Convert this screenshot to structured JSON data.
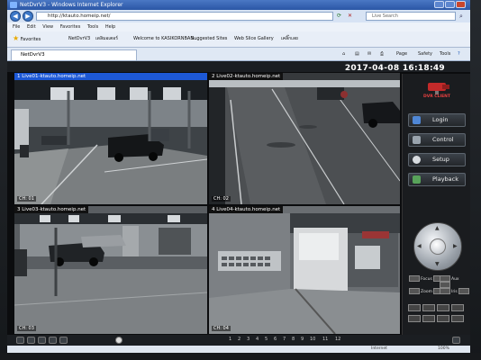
{
  "window": {
    "title": "NetDvrV3 - Windows Internet Explorer"
  },
  "address_bar": {
    "url": "http://ktauto.homeip.net/",
    "search_placeholder": "Live Search"
  },
  "menu": [
    "File",
    "Edit",
    "View",
    "Favorites",
    "Tools",
    "Help"
  ],
  "favorites_bar": {
    "label": "Favorites",
    "items": [
      "NetDvrV3",
      "เดลิมอเตอร์",
      "Welcome to KASIKORNBAN...",
      "Suggested Sites",
      "Web Slice Gallery",
      "เคลิ๊กเลย"
    ]
  },
  "tab": {
    "title": "NetDvrV3"
  },
  "command_bar": {
    "page": "Page",
    "safety": "Safety",
    "tools": "Tools"
  },
  "nvr": {
    "datetime": "2017-04-08 16:18:49",
    "cameras": [
      {
        "label": "1 Live01-ktauto.homeip.net",
        "selected": true
      },
      {
        "label": "2 Live02-ktauto.homeip.net",
        "selected": false
      },
      {
        "label": "3 Live03-ktauto.homeip.net",
        "selected": false
      },
      {
        "label": "4 Live04-ktauto.homeip.net",
        "selected": false
      }
    ],
    "channel_badges": [
      "CH: 01",
      "CH: 02",
      "CH: 03",
      "CH: 04"
    ],
    "logo_text": "DVR CLIENT",
    "buttons": {
      "login": "Login",
      "control": "Control",
      "setup": "Setup",
      "playback": "Playback"
    },
    "ptz": {
      "focus": "Focus",
      "aux": "Aux",
      "zoom": "Zoom",
      "iris": "Iris"
    },
    "pages": [
      "1",
      "2",
      "3",
      "4",
      "5",
      "6",
      "7",
      "8",
      "9",
      "10",
      "11",
      "12"
    ]
  },
  "status": {
    "zone": "Internet",
    "zoom": "100%"
  }
}
